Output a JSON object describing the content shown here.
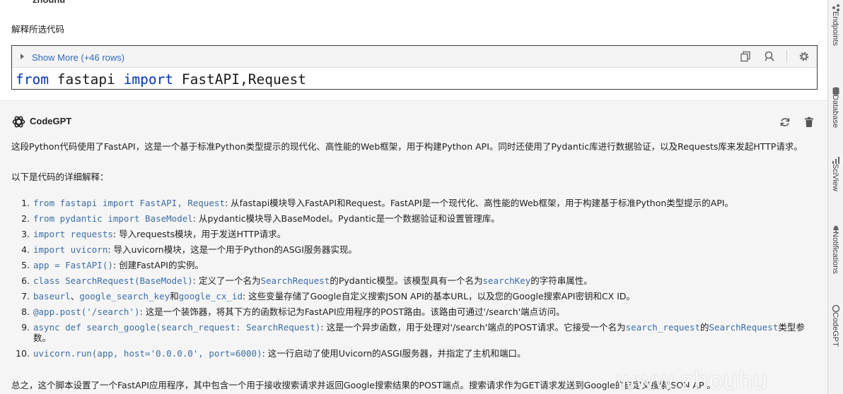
{
  "user": {
    "name": "zhouhu",
    "message": "解释所选代码",
    "code": {
      "show_more": "Show More (+46 rows)",
      "line_kw1": "from",
      "line_mod": " fastapi ",
      "line_kw2": "import",
      "line_names": " FastAPI,Request"
    }
  },
  "assistant": {
    "name": "CodeGPT",
    "intro": "这段Python代码使用了FastAPI，这是一个基于标准Python类型提示的现代化、高性能的Web框架，用于构建Python API。同时还使用了Pydantic库进行数据验证，以及Requests库来发起HTTP请求。",
    "detail_heading": "以下是代码的详细解释：",
    "items": [
      {
        "num": "1.",
        "code": "from fastapi import FastAPI, Request",
        "text": ": 从fastapi模块导入FastAPI和Request。FastAPI是一个现代化、高性能的Web框架，用于构建基于标准Python类型提示的API。"
      },
      {
        "num": "2.",
        "code": "from pydantic import BaseModel",
        "text": ": 从pydantic模块导入BaseModel。Pydantic是一个数据验证和设置管理库。"
      },
      {
        "num": "3.",
        "code": "import requests",
        "text": ": 导入requests模块，用于发送HTTP请求。"
      },
      {
        "num": "4.",
        "code": "import uvicorn",
        "text": ": 导入uvicorn模块，这是一个用于Python的ASGI服务器实现。"
      },
      {
        "num": "5.",
        "code": "app = FastAPI()",
        "text": ": 创建FastAPI的实例。"
      },
      {
        "num": "6.",
        "code": "class SearchRequest(BaseModel)",
        "text": ": 定义了一个名为",
        "code2": "SearchRequest",
        "text2": "的Pydantic模型。该模型具有一个名为",
        "code3": "searchKey",
        "text3": "的字符串属性。"
      },
      {
        "num": "7.",
        "code": "baseurl",
        "text": "、",
        "code2": "google_search_key",
        "text2": "和",
        "code3": "google_cx_id",
        "text3": ": 这些变量存储了Google自定义搜索JSON API的基本URL，以及您的Google搜索API密钥和CX ID。"
      },
      {
        "num": "8.",
        "code": "@app.post('/search')",
        "text": ": 这是一个装饰器，将其下方的函数标记为FastAPI应用程序的POST路由。该路由可通过'/search'端点访问。"
      },
      {
        "num": "9.",
        "code": "async def search_google(search_request: SearchRequest)",
        "text": ": 这是一个异步函数，用于处理对'/search'端点的POST请求。它接受一个名为",
        "code2": "search_request",
        "text2": "的",
        "code3": "SearchRequest",
        "text3": "类型参数。"
      },
      {
        "num": "10.",
        "code": "uvicorn.run(app, host='0.0.0.0', port=6000)",
        "text": ": 这一行启动了使用Uvicorn的ASGI服务器，并指定了主机和端口。"
      }
    ],
    "summary": "总之，这个脚本设置了一个FastAPI应用程序，其中包含一个用于接收搜索请求并返回Google搜索结果的POST端点。搜索请求作为GET请求发送到Google的自定义搜索JSON API。"
  },
  "right_strip": {
    "items": [
      "Endpoints",
      "Database",
      "SciView",
      "Notifications",
      "CodeGPT"
    ]
  },
  "watermark": "www.zhouhu"
}
